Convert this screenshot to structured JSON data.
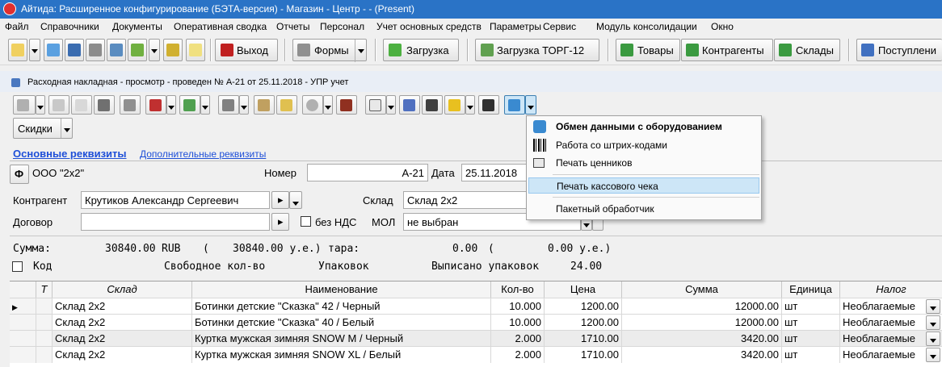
{
  "window": {
    "title": "Айтида: Расширенное конфигурирование (БЭТА-версия) - Магазин - Центр -  - (Present)"
  },
  "menu": [
    "Файл",
    "Справочники",
    "Документы",
    "Оперативная сводка",
    "Отчеты",
    "Персонал",
    "Учет основных средств",
    "Параметры",
    "Сервис",
    "Модуль консолидации",
    "Окно"
  ],
  "toolbar": {
    "exit_label": "Выход",
    "forms_label": "Формы",
    "load_label": "Загрузка",
    "load_torg_label": "Загрузка ТОРГ-12",
    "goods_label": "Товары",
    "contractors_label": "Контрагенты",
    "warehouses_label": "Склады",
    "receipts_label": "Поступлени"
  },
  "document": {
    "title": "Расходная накладная - просмотр - проведен № А-21 от 25.11.2018 - УПР учет",
    "discounts_label": "Скидки",
    "tab_main": "Основные реквизиты",
    "tab_extra": "Дополнительные реквизиты",
    "org_button": "Ф",
    "org_name": "ООО \"2х2\"",
    "number_label": "Номер",
    "number_value": "А-21",
    "date_label": "Дата",
    "date_value": "25.11.2018",
    "contractor_label": "Контрагент",
    "contractor_value": "Крутиков Александр Сергеевич",
    "warehouse_label": "Склад",
    "warehouse_value": "Склад 2х2",
    "contract_label": "Договор",
    "contract_value": "",
    "no_vat_label": "без НДС",
    "mol_label": "МОЛ",
    "mol_value": "не выбран"
  },
  "summary": {
    "sum_label": "Сумма:",
    "sum_value": "30840.00",
    "currency": "RUB",
    "paren_open": "(",
    "sum_ue": "30840.00 у.е.)",
    "tara_label": "тара:",
    "tara_value": "0.00",
    "tara_paren": "(",
    "tara_ue": "0.00 у.е.)",
    "code_label": "Код",
    "free_qty_label": "Свободное кол-во",
    "pack_label": "Упаковок",
    "written_pack_label": "Выписано упаковок",
    "written_pack_value": "24.00"
  },
  "grid": {
    "columns": [
      "Т",
      "Склад",
      "Наименование",
      "Кол-во",
      "Цена",
      "Сумма",
      "Единица",
      "Налог"
    ],
    "rows": [
      {
        "warehouse": "Склад 2х2",
        "name": "Ботинки детские \"Сказка\" 42 / Черный",
        "qty": "10.000",
        "price": "1200.00",
        "sum": "12000.00",
        "unit": "шт",
        "tax": "Необлагаемые"
      },
      {
        "warehouse": "Склад 2х2",
        "name": "Ботинки детские \"Сказка\" 40 / Белый",
        "qty": "10.000",
        "price": "1200.00",
        "sum": "12000.00",
        "unit": "шт",
        "tax": "Необлагаемые"
      },
      {
        "warehouse": "Склад 2х2",
        "name": "Куртка мужская зимняя SNOW M / Черный",
        "qty": "2.000",
        "price": "1710.00",
        "sum": "3420.00",
        "unit": "шт",
        "tax": "Необлагаемые"
      },
      {
        "warehouse": "Склад 2х2",
        "name": "Куртка мужская зимняя SNOW XL / Белый",
        "qty": "2.000",
        "price": "1710.00",
        "sum": "3420.00",
        "unit": "шт",
        "tax": "Необлагаемые"
      }
    ]
  },
  "popup_menu": {
    "items": [
      "Обмен данными с оборудованием",
      "Работа со штрих-кодами",
      "Печать ценников",
      "Печать кассового чека",
      "Пакетный обработчик"
    ],
    "highlighted_index": 3
  },
  "colors": {
    "titlebar": "#2a73c6",
    "highlight": "#cde6f7",
    "link": "#1e4fd8"
  }
}
